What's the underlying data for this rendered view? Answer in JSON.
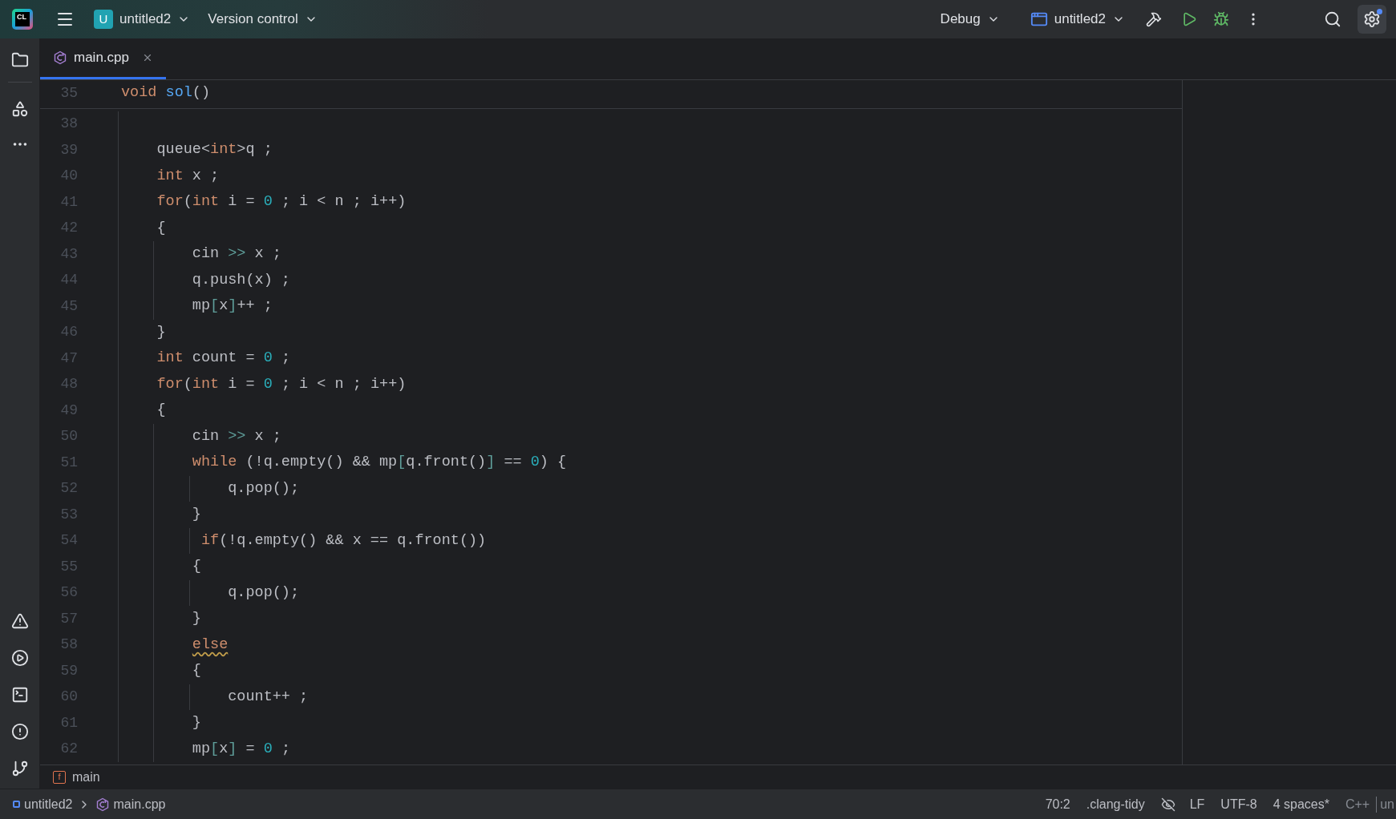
{
  "toolbar": {
    "logo": "CL",
    "project": {
      "badge": "U",
      "name": "untitled2"
    },
    "vcs": "Version control",
    "run_config": "Debug",
    "target": "untitled2"
  },
  "tabs": [
    {
      "label": "main.cpp",
      "selected": true
    }
  ],
  "sticky_line": {
    "number": "35",
    "tokens": [
      {
        "text": "void",
        "kind": "kw"
      },
      {
        "text": " sol",
        "kind": "fn"
      },
      {
        "text": "()",
        "kind": "plain"
      }
    ]
  },
  "lines": [
    {
      "number": "38"
    },
    {
      "number": "39",
      "tokens": [
        {
          "text": "    queue<",
          "kind": "plain"
        },
        {
          "text": "int",
          "kind": "kw"
        },
        {
          "text": ">q ;",
          "kind": "plain"
        }
      ]
    },
    {
      "number": "40",
      "tokens": [
        {
          "text": "    int",
          "kind": "kw"
        },
        {
          "text": " x ;",
          "kind": "plain"
        }
      ]
    },
    {
      "number": "41",
      "tokens": [
        {
          "text": "    for",
          "kind": "kw"
        },
        {
          "text": "(",
          "kind": "plain"
        },
        {
          "text": "int",
          "kind": "kw"
        },
        {
          "text": " i = ",
          "kind": "plain"
        },
        {
          "text": "0",
          "kind": "num"
        },
        {
          "text": " ; i < n ; i++)",
          "kind": "plain"
        }
      ]
    },
    {
      "number": "42",
      "tokens": [
        {
          "text": "    {",
          "kind": "plain"
        }
      ]
    },
    {
      "number": "43",
      "tokens": [
        {
          "text": "        cin ",
          "kind": "plain"
        },
        {
          "text": ">>",
          "kind": "op"
        },
        {
          "text": " x ;",
          "kind": "plain"
        }
      ]
    },
    {
      "number": "44",
      "tokens": [
        {
          "text": "        q.push(x) ;",
          "kind": "plain"
        }
      ]
    },
    {
      "number": "45",
      "tokens": [
        {
          "text": "        mp",
          "kind": "plain"
        },
        {
          "text": "[",
          "kind": "op"
        },
        {
          "text": "x",
          "kind": "plain"
        },
        {
          "text": "]",
          "kind": "op"
        },
        {
          "text": "++ ;",
          "kind": "plain"
        }
      ]
    },
    {
      "number": "46",
      "tokens": [
        {
          "text": "    }",
          "kind": "plain"
        }
      ]
    },
    {
      "number": "47",
      "tokens": [
        {
          "text": "    int",
          "kind": "kw"
        },
        {
          "text": " count = ",
          "kind": "plain"
        },
        {
          "text": "0",
          "kind": "num"
        },
        {
          "text": " ;",
          "kind": "plain"
        }
      ]
    },
    {
      "number": "48",
      "tokens": [
        {
          "text": "    for",
          "kind": "kw"
        },
        {
          "text": "(",
          "kind": "plain"
        },
        {
          "text": "int",
          "kind": "kw"
        },
        {
          "text": " i = ",
          "kind": "plain"
        },
        {
          "text": "0",
          "kind": "num"
        },
        {
          "text": " ; i < n ; i++)",
          "kind": "plain"
        }
      ]
    },
    {
      "number": "49",
      "tokens": [
        {
          "text": "    {",
          "kind": "plain"
        }
      ]
    },
    {
      "number": "50",
      "tokens": [
        {
          "text": "        cin ",
          "kind": "plain"
        },
        {
          "text": ">>",
          "kind": "op"
        },
        {
          "text": " x ;",
          "kind": "plain"
        }
      ]
    },
    {
      "number": "51",
      "tokens": [
        {
          "text": "        while",
          "kind": "kw"
        },
        {
          "text": " (!q.empty() && mp",
          "kind": "plain"
        },
        {
          "text": "[",
          "kind": "op"
        },
        {
          "text": "q.front()",
          "kind": "plain"
        },
        {
          "text": "]",
          "kind": "op"
        },
        {
          "text": " == ",
          "kind": "plain"
        },
        {
          "text": "0",
          "kind": "num"
        },
        {
          "text": ") {",
          "kind": "plain"
        }
      ]
    },
    {
      "number": "52",
      "tokens": [
        {
          "text": "            q.pop();",
          "kind": "plain"
        }
      ]
    },
    {
      "number": "53",
      "tokens": [
        {
          "text": "        }",
          "kind": "plain"
        }
      ]
    },
    {
      "number": "54",
      "tokens": [
        {
          "text": "         if",
          "kind": "kw"
        },
        {
          "text": "(!q.empty() && x == q.front())",
          "kind": "plain"
        }
      ]
    },
    {
      "number": "55",
      "tokens": [
        {
          "text": "        {",
          "kind": "plain"
        }
      ]
    },
    {
      "number": "56",
      "tokens": [
        {
          "text": "            q.pop();",
          "kind": "plain"
        }
      ]
    },
    {
      "number": "57",
      "tokens": [
        {
          "text": "        }",
          "kind": "plain"
        }
      ]
    },
    {
      "number": "58",
      "tokens": [
        {
          "text": "        else",
          "kind": "kw",
          "warning": true
        }
      ]
    },
    {
      "number": "59",
      "tokens": [
        {
          "text": "        {",
          "kind": "plain"
        }
      ]
    },
    {
      "number": "60",
      "tokens": [
        {
          "text": "            count++ ;",
          "kind": "plain"
        }
      ]
    },
    {
      "number": "61",
      "tokens": [
        {
          "text": "        }",
          "kind": "plain"
        }
      ]
    },
    {
      "number": "62",
      "tokens": [
        {
          "text": "        mp",
          "kind": "plain"
        },
        {
          "text": "[",
          "kind": "op"
        },
        {
          "text": "x",
          "kind": "plain"
        },
        {
          "text": "]",
          "kind": "op"
        },
        {
          "text": " = ",
          "kind": "plain"
        },
        {
          "text": "0",
          "kind": "num"
        },
        {
          "text": " ;",
          "kind": "plain"
        }
      ]
    }
  ],
  "breadcrumb": {
    "badge": "f",
    "function": "main"
  },
  "status_bar": {
    "path": [
      "untitled2",
      "main.cpp"
    ],
    "position": "70:2",
    "inspection": ".clang-tidy",
    "line_ending": "LF",
    "encoding": "UTF-8",
    "indent": "4 spaces*",
    "language": "C++",
    "overflow": "un"
  }
}
